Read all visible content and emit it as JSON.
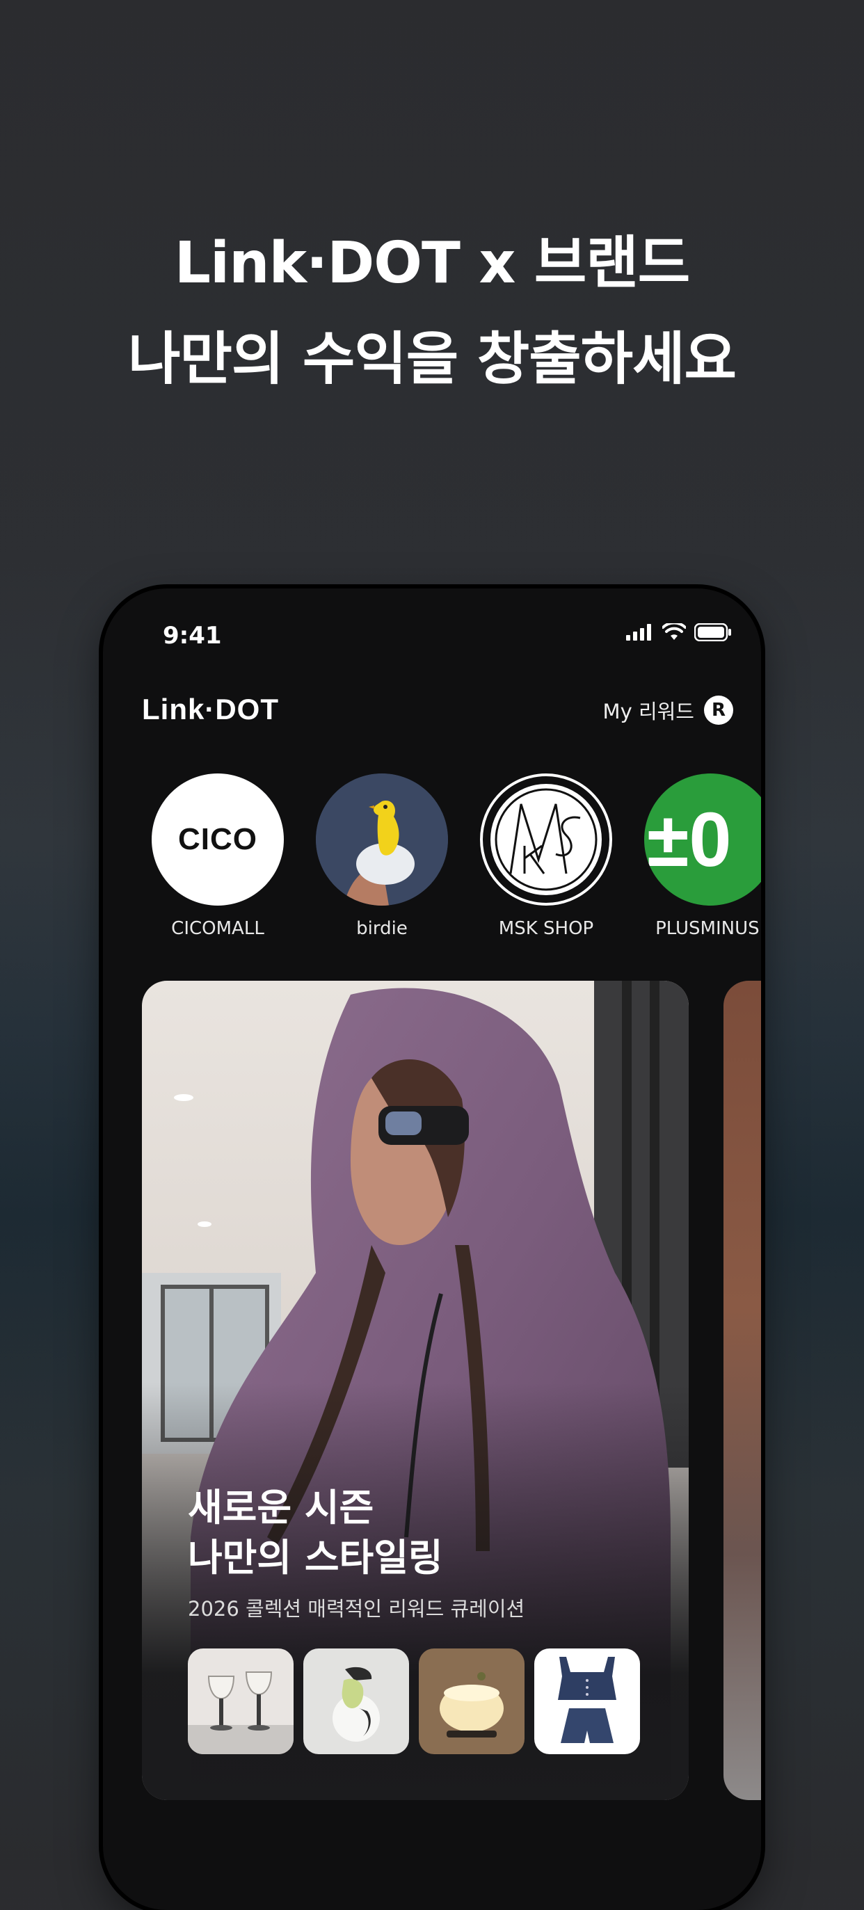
{
  "headline": {
    "line1": "Link·DOT x 브랜드",
    "line2": "나만의 수익을 창출하세요"
  },
  "status_bar": {
    "time": "9:41"
  },
  "app_header": {
    "logo": "Link·DOT",
    "reward_label": "My 리워드",
    "reward_badge": "R"
  },
  "brands": [
    {
      "name": "CICOMALL",
      "logo_text": "CICO"
    },
    {
      "name": "birdie"
    },
    {
      "name": "MSK SHOP"
    },
    {
      "name": "PLUSMINUS·",
      "logo_text": "±0"
    }
  ],
  "feature_card": {
    "title_line1": "새로운 시즌",
    "title_line2": "나만의 스타일링",
    "subtitle": "2026 콜렉션 매력적인 리워드 큐레이션"
  },
  "colors": {
    "background": "#2b2c2f",
    "phone": "#0f0f10",
    "plusminus_green": "#2a9d3b"
  }
}
